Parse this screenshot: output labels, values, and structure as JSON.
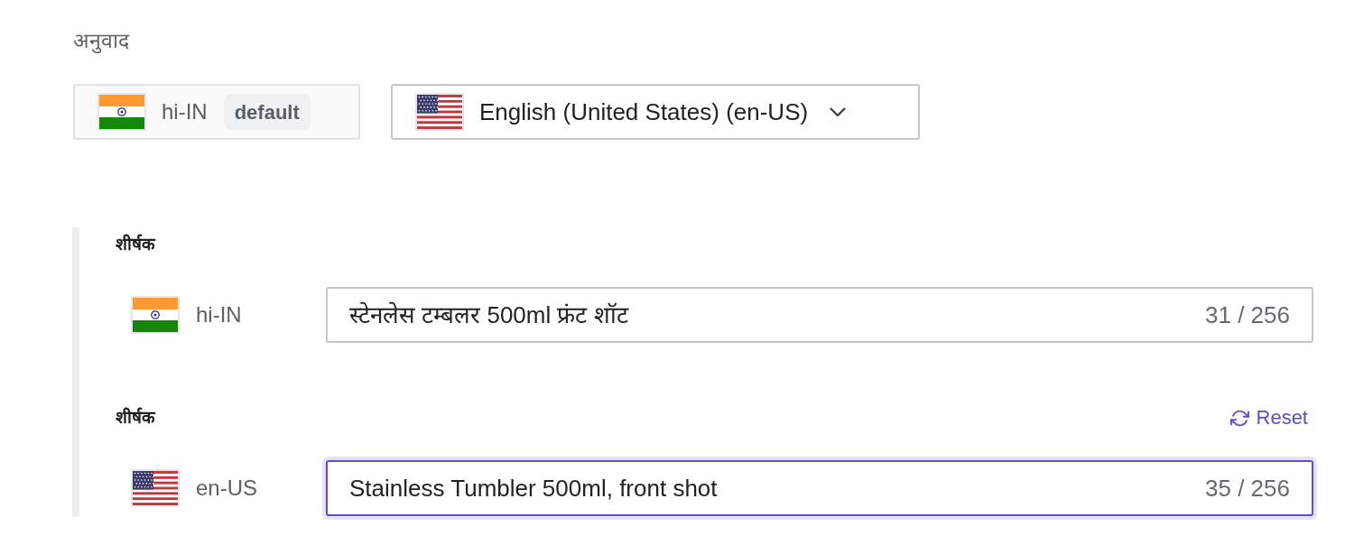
{
  "section": {
    "title": "अनुवाद"
  },
  "locales": {
    "default": {
      "code": "hi-IN",
      "badge": "default"
    },
    "target": {
      "label": "English (United States) (en-US)"
    }
  },
  "fields": [
    {
      "kind": "source",
      "label": "शीर्षक",
      "locale": "hi-IN",
      "value": "स्टेनलेस टम्बलर 500ml फ्रंट शॉट",
      "counter": "31 / 256",
      "focused": false
    },
    {
      "kind": "translation",
      "label": "शीर्षक",
      "locale": "en-US",
      "value": "Stainless Tumbler 500ml, front shot",
      "counter": "35 / 256",
      "focused": true,
      "reset": "Reset"
    }
  ]
}
